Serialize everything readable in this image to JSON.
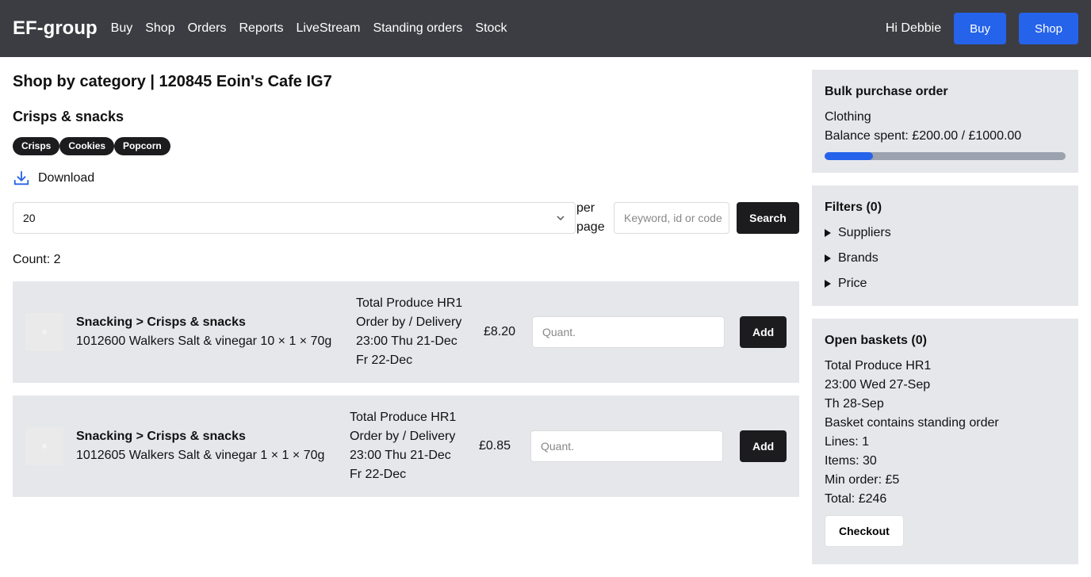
{
  "navbar": {
    "brand": "EF-group",
    "links": [
      "Buy",
      "Shop",
      "Orders",
      "Reports",
      "LiveStream",
      "Standing orders",
      "Stock"
    ],
    "greeting": "Hi Debbie",
    "buy_button": "Buy",
    "shop_button": "Shop"
  },
  "main": {
    "title": "Shop by category | 120845 Eoin's Cafe IG7",
    "category": "Crisps & snacks",
    "chips": [
      "Crisps",
      "Cookies",
      "Popcorn"
    ],
    "download_label": "Download",
    "per_page_value": "20",
    "per_page_label": "per page",
    "search_placeholder": "Keyword, id or code",
    "search_button": "Search",
    "count": "Count: 2"
  },
  "products": [
    {
      "category": "Snacking > Crisps & snacks",
      "name": "1012600 Walkers Salt & vinegar 10 × 1 × 70g",
      "supplier": "Total Produce HR1",
      "order_by_label": "Order by / Delivery",
      "order_by": "23:00 Thu 21-Dec",
      "delivery": "Fr 22-Dec",
      "price": "£8.20",
      "qty_placeholder": "Quant.",
      "add_label": "Add"
    },
    {
      "category": "Snacking > Crisps & snacks",
      "name": "1012605 Walkers Salt & vinegar 1 × 1 × 70g",
      "supplier": "Total Produce HR1",
      "order_by_label": "Order by / Delivery",
      "order_by": "23:00 Thu 21-Dec",
      "delivery": "Fr 22-Dec",
      "price": "£0.85",
      "qty_placeholder": "Quant.",
      "add_label": "Add"
    }
  ],
  "sidebar": {
    "bulk": {
      "title": "Bulk purchase order",
      "category": "Clothing",
      "balance": "Balance spent: £200.00 / £1000.00",
      "progress_fraction": 0.2
    },
    "filters": {
      "title": "Filters (0)",
      "items": [
        "Suppliers",
        "Brands",
        "Price"
      ]
    },
    "baskets": {
      "title": "Open baskets (0)",
      "lines": [
        "Total Produce HR1",
        "23:00 Wed 27-Sep",
        "Th 28-Sep",
        "Basket contains standing order",
        "Lines: 1",
        "Items: 30",
        "Min order: £5",
        "Total: £246"
      ],
      "checkout_label": "Checkout"
    }
  },
  "colors": {
    "navbar": "#3c3d42",
    "accent": "#2563eb",
    "dark_button": "#1c1c1e",
    "panel": "#e5e7eb"
  }
}
